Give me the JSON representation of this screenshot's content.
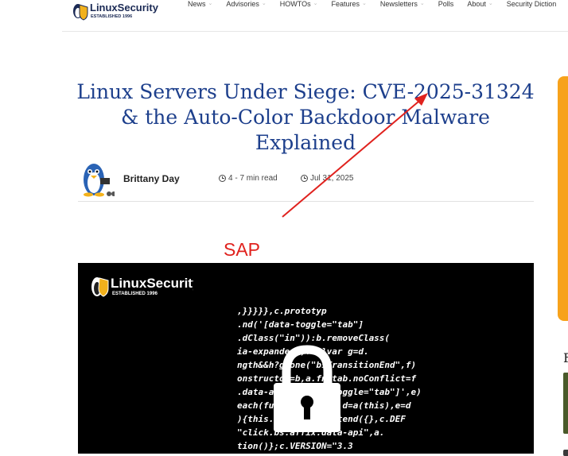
{
  "header": {
    "logo_text": "LinuxSecurity",
    "logo_tagline": "ESTABLISHED 1996",
    "nav": [
      {
        "label": "News",
        "dropdown": true
      },
      {
        "label": "Advisories",
        "dropdown": true
      },
      {
        "label": "HOWTOs",
        "dropdown": true
      },
      {
        "label": "Features",
        "dropdown": true
      },
      {
        "label": "Newsletters",
        "dropdown": true
      },
      {
        "label": "Polls",
        "dropdown": false
      },
      {
        "label": "About",
        "dropdown": true
      },
      {
        "label": "Security Diction",
        "dropdown": false
      }
    ]
  },
  "article": {
    "title": "Linux Servers Under Siege: CVE-2025-31324 & the Auto-Color Backdoor Malware Explained",
    "author": "Brittany Day",
    "read_time": "4 - 7 min read",
    "date": "Jul 31, 2025"
  },
  "annotation": {
    "label": "SAP",
    "color": "#e0221e"
  },
  "featured_image": {
    "logo_text": "LinuxSecurity",
    "logo_tagline": "ESTABLISHED 1996",
    "code": [
      ",}}}}},c.prototyp",
      ".nd('[data-toggle=\"tab\"]",
      ".dClass(\"in\")):b.removeClass(",
      "ia-expanded\",!0)}var g=d.",
      "ngth&&h?g.one(\"bsTransitionEnd\",f)",
      "onstructor=b,a.fn.tab.noConflict=f",
      ".data-api\",'[data-toggle=\"tab\"]',e)",
      "each(function(){var d=a(this),e=d",
      "){this.options=a.extend({},c.DEF",
      "\"click.bs.affix.data-api\",a.",
      "tion()};c.VERSION=\"3.3"
    ]
  },
  "sidebar": {
    "heading_initial": "F"
  },
  "colors": {
    "title": "#1d3f8c",
    "banner": "#f7a21b",
    "annotation": "#e0221e"
  }
}
